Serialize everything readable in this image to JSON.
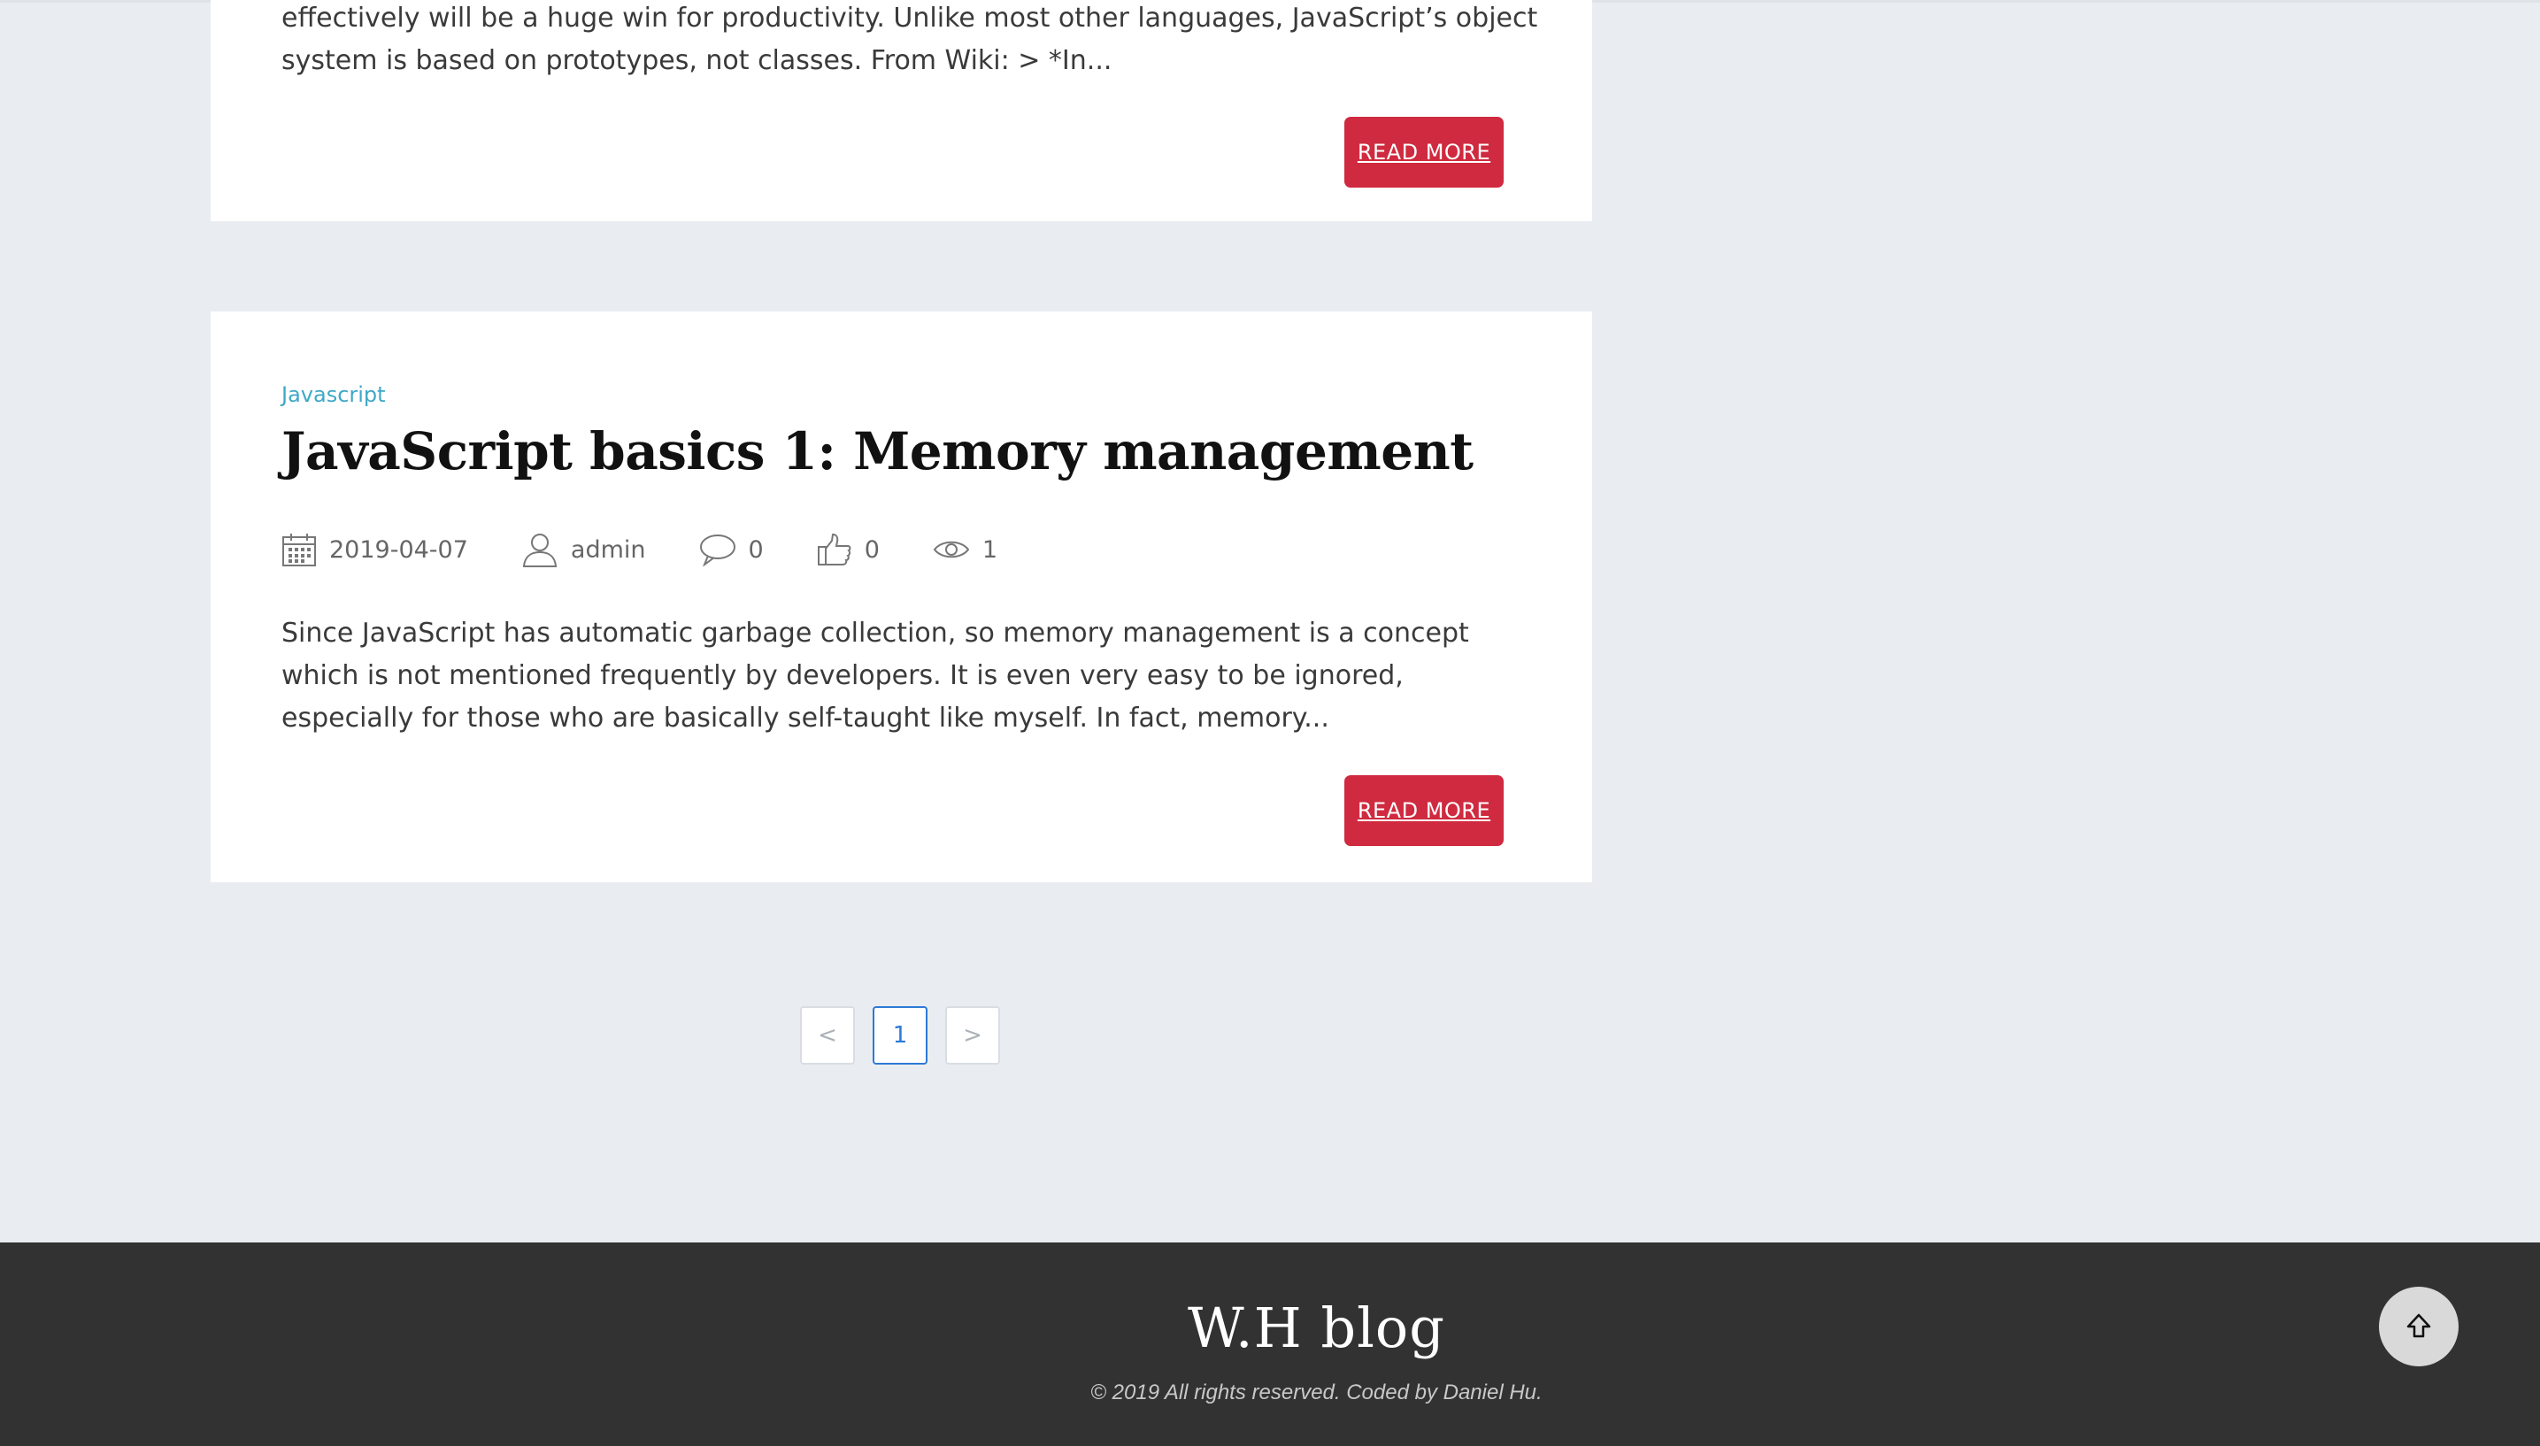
{
  "posts": [
    {
      "excerpt": "effectively will be a huge win for productivity. Unlike most other languages, JavaScript’s object system is based on prototypes, not classes. From Wiki: > *In...",
      "read_more": "READ MORE"
    },
    {
      "category": "Javascript",
      "title": "JavaScript basics 1: Memory management",
      "date": "2019-04-07",
      "author": "admin",
      "comments": "0",
      "likes": "0",
      "views": "1",
      "excerpt": "Since JavaScript has automatic garbage collection, so memory management is a concept which is not mentioned frequently by developers. It is even very easy to be ignored, especially for those who are basically self-taught like myself. In fact, memory...",
      "read_more": "READ MORE"
    }
  ],
  "pagination": {
    "prev": "<",
    "current": "1",
    "next": ">"
  },
  "footer": {
    "brand": "W.H blog",
    "copyright": "© 2019 All rights reserved. Coded by Daniel Hu."
  },
  "icons": {
    "date": "calendar-icon",
    "author": "user-icon",
    "comments": "comment-icon",
    "likes": "thumbs-up-icon",
    "views": "eye-icon",
    "back_to_top": "arrow-up-icon"
  },
  "colors": {
    "accent_button": "#cf2a3f",
    "category_link": "#3ea8c6",
    "page_active": "#2d7ad6",
    "footer_bg": "#323232",
    "page_bg": "#e9edf1"
  }
}
